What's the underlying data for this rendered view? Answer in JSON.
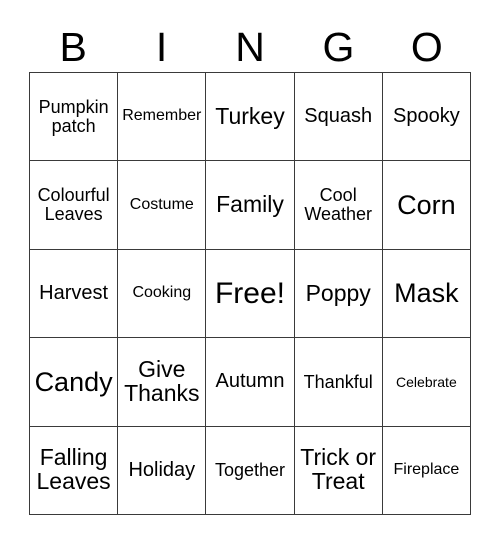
{
  "card": {
    "type": "bingo-card",
    "theme": "autumn-thanksgiving-halloween",
    "columns": 5,
    "rows": 5,
    "background_color": "#ffffff",
    "border_color": "#3a3a3a",
    "text_color": "#000000"
  },
  "header": {
    "letters": [
      "B",
      "I",
      "N",
      "G",
      "O"
    ]
  },
  "grid": {
    "rows": [
      {
        "cells": [
          {
            "text": "Pumpkin\npatch",
            "size": "md"
          },
          {
            "text": "Remember",
            "size": "sm"
          },
          {
            "text": "Turkey",
            "size": "xl"
          },
          {
            "text": "Squash",
            "size": "lg"
          },
          {
            "text": "Spooky",
            "size": "lg"
          }
        ]
      },
      {
        "cells": [
          {
            "text": "Colourful\nLeaves",
            "size": "md"
          },
          {
            "text": "Costume",
            "size": "sm"
          },
          {
            "text": "Family",
            "size": "xl"
          },
          {
            "text": "Cool\nWeather",
            "size": "md"
          },
          {
            "text": "Corn",
            "size": "xxl"
          }
        ]
      },
      {
        "cells": [
          {
            "text": "Harvest",
            "size": "lg"
          },
          {
            "text": "Cooking",
            "size": "sm"
          },
          {
            "text": "Free!",
            "size": "free"
          },
          {
            "text": "Poppy",
            "size": "xl"
          },
          {
            "text": "Mask",
            "size": "xxl"
          }
        ]
      },
      {
        "cells": [
          {
            "text": "Candy",
            "size": "xxl"
          },
          {
            "text": "Give\nThanks",
            "size": "xl"
          },
          {
            "text": "Autumn",
            "size": "lg"
          },
          {
            "text": "Thankful",
            "size": "md"
          },
          {
            "text": "Celebrate",
            "size": "xs"
          }
        ]
      },
      {
        "cells": [
          {
            "text": "Falling\nLeaves",
            "size": "xl"
          },
          {
            "text": "Holiday",
            "size": "lg"
          },
          {
            "text": "Together",
            "size": "md"
          },
          {
            "text": "Trick or\nTreat",
            "size": "xl"
          },
          {
            "text": "Fireplace",
            "size": "sm"
          }
        ]
      }
    ]
  }
}
